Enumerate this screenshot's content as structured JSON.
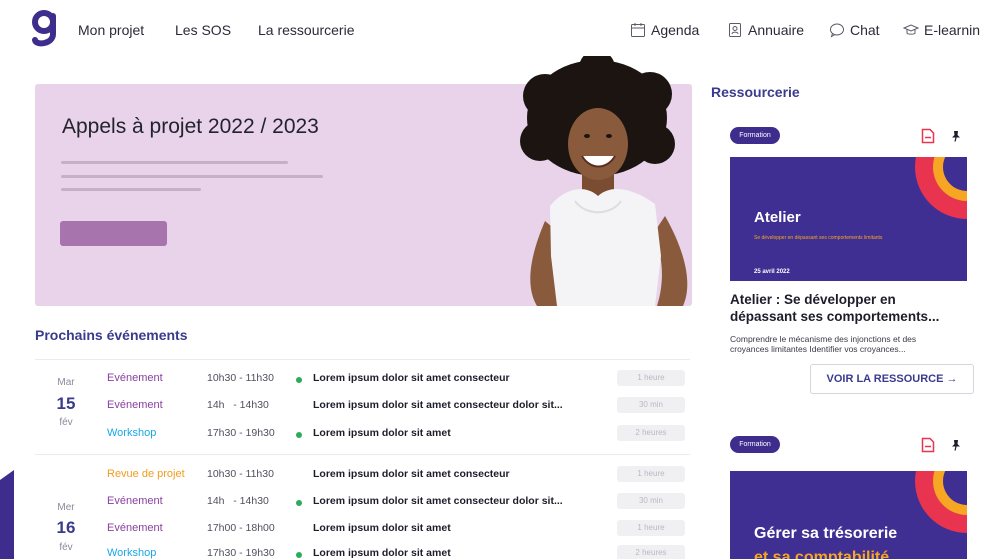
{
  "nav": {
    "items": [
      "Mon projet",
      "Les SOS",
      "La ressourcerie"
    ],
    "tools": [
      "Agenda",
      "Annuaire",
      "Chat",
      "E-learnin"
    ]
  },
  "hero": {
    "title": "Appels à projet 2022 / 2023"
  },
  "events": {
    "title": "Prochains événements",
    "days": [
      {
        "weekday": "Mar",
        "number": "15",
        "month": "fév",
        "rows": [
          {
            "type": "Evénement",
            "color": "#8a3fa0",
            "time": "10h30 - 11h30",
            "dot": true,
            "title": "Lorem ipsum dolor sit amet consecteur",
            "duration": "1 heure"
          },
          {
            "type": "Evénement",
            "color": "#8a3fa0",
            "time": "14h   - 14h30",
            "dot": false,
            "title": "Lorem ipsum dolor sit amet consecteur dolor sit...",
            "duration": "30 min"
          },
          {
            "type": "Workshop",
            "color": "#1aa6e6",
            "time": "17h30 - 19h30",
            "dot": true,
            "title": "Lorem ipsum dolor sit amet",
            "duration": "2 heures"
          }
        ]
      },
      {
        "weekday": "Mer",
        "number": "16",
        "month": "fév",
        "rows": [
          {
            "type": "Revue de projet",
            "color": "#f29b1d",
            "time": "10h30 - 11h30",
            "dot": false,
            "title": "Lorem ipsum dolor sit amet consecteur",
            "duration": "1 heure"
          },
          {
            "type": "Evénement",
            "color": "#8a3fa0",
            "time": "14h   - 14h30",
            "dot": true,
            "title": "Lorem ipsum dolor sit amet consecteur dolor sit...",
            "duration": "30 min"
          },
          {
            "type": "Evénement",
            "color": "#8a3fa0",
            "time": "17h00 - 18h00",
            "dot": false,
            "title": "Lorem ipsum dolor sit amet",
            "duration": "1 heure"
          },
          {
            "type": "Workshop",
            "color": "#1aa6e6",
            "time": "17h30 - 19h30",
            "dot": true,
            "title": "Lorem ipsum dolor sit amet",
            "duration": "2 heures"
          }
        ]
      }
    ]
  },
  "ressourcerie": {
    "title": "Ressourcerie",
    "card1": {
      "tag": "Formation",
      "image_title": "Atelier",
      "image_subtitle": "Se développer en dépassant ses comportements limitants",
      "image_date": "25 avril 2022",
      "title_line1": "Atelier : Se développer en",
      "title_line2": "dépassant ses comportements...",
      "desc_line1": "Comprendre le mécanisme des injonctions et des",
      "desc_line2": "croyances limitantes Identifier vos croyances...",
      "button": "VOIR LA RESSOURCE →"
    },
    "card2": {
      "tag": "Formation",
      "image_title": "Gérer sa trésorerie",
      "image_title2": "et sa comptabilité"
    }
  },
  "colors": {
    "brand": "#3e2d8c",
    "hero_bg": "#e9d3ea",
    "accent_orange": "#f6a623",
    "accent_red": "#e8344e",
    "dot_green": "#2faa5c"
  }
}
